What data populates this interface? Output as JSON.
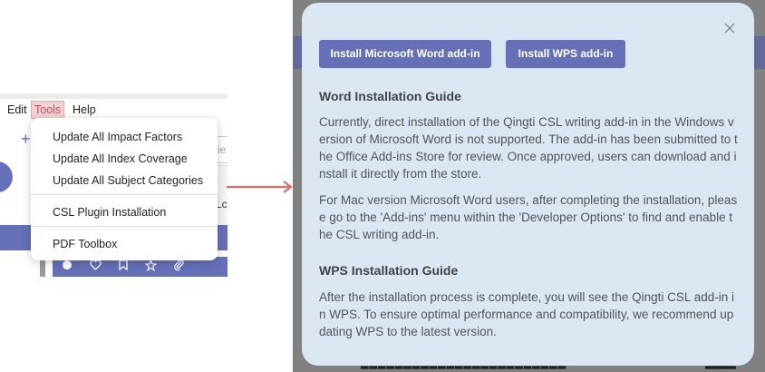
{
  "menubar": {
    "edit_label": "Edit",
    "tools_label": "Tools",
    "help_label": "Help"
  },
  "tools_menu": {
    "items": [
      "Update All Impact Factors",
      "Update All Index Coverage",
      "Update All Subject Categories",
      "CSL Plugin Installation",
      "PDF Toolbox"
    ]
  },
  "background_left": {
    "partial_label_right": "Lc",
    "partial_label_input": "ie"
  },
  "dialog": {
    "buttons": {
      "word": "Install Microsoft Word add-in",
      "wps": "Install WPS add-in"
    },
    "word_guide": {
      "title": "Word Installation Guide",
      "para1": "Currently, direct installation of the Qingti CSL writing add-in in the Windows version of Microsoft Word is not supported. The add-in has been submitted to the Office Add-ins Store for review. Once approved, users can download and install it directly from the store.",
      "para2": "For Mac version Microsoft Word users, after completing the installation, please go to the 'Add-ins' menu within the 'Developer Options' to find and enable the CSL writing add-in."
    },
    "wps_guide": {
      "title": "WPS Installation Guide",
      "para1": "After the installation process is complete, you will see the Qingti CSL add-in in WPS. To ensure optimal performance and compatibility, we recommend updating WPS to the latest version."
    }
  },
  "colors": {
    "accent": "#6670b8",
    "dialog_bg": "#dbe6f3",
    "arrow": "#e06a6a",
    "tools_highlight": "#f4d3d6"
  }
}
